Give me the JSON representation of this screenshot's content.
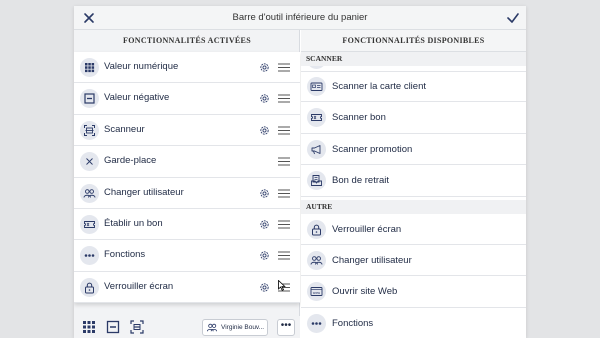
{
  "dialog": {
    "title": "Barre d'outil inférieure du panier",
    "close_icon": "close-icon",
    "confirm_icon": "check-icon"
  },
  "left": {
    "header": "Fonctionnalités activées",
    "items": [
      {
        "label": "Valeur numérique",
        "icon": "numeric-keypad-icon",
        "has_settings": true
      },
      {
        "label": "Valeur négative",
        "icon": "minus-box-icon",
        "has_settings": true
      },
      {
        "label": "Scanneur",
        "icon": "barcode-scanner-icon",
        "has_settings": true
      },
      {
        "label": "Garde-place",
        "icon": "x-placeholder-icon",
        "has_settings": false
      },
      {
        "label": "Changer utilisateur",
        "icon": "users-icon",
        "has_settings": true
      },
      {
        "label": "Établir un bon",
        "icon": "ticket-icon",
        "has_settings": true
      },
      {
        "label": "Fonctions",
        "icon": "more-dots-icon",
        "has_settings": true
      },
      {
        "label": "Verrouiller écran",
        "icon": "lock-icon",
        "has_settings": true
      }
    ],
    "footer": {
      "user_label": "Virginie Bouv...",
      "more_label": "•••"
    }
  },
  "right": {
    "header": "Fonctionnalités disponibles",
    "sections": [
      {
        "title": "Scanner",
        "items": [
          {
            "label": "Scanner la carte client",
            "icon": "card-icon"
          },
          {
            "label": "Scanner bon",
            "icon": "ticket-scan-icon"
          },
          {
            "label": "Scanner promotion",
            "icon": "megaphone-icon"
          },
          {
            "label": "Bon de retrait",
            "icon": "receipt-icon"
          }
        ]
      },
      {
        "title": "Autre",
        "items": [
          {
            "label": "Verrouiller écran",
            "icon": "lock-icon"
          },
          {
            "label": "Changer utilisateur",
            "icon": "users-icon"
          },
          {
            "label": "Ouvrir site Web",
            "icon": "web-icon"
          },
          {
            "label": "Fonctions",
            "icon": "more-dots-icon"
          }
        ]
      }
    ]
  },
  "colors": {
    "accent": "#2b3a67",
    "icon_bg": "#e4e7ee",
    "panel_bg": "#f2f3f5"
  }
}
